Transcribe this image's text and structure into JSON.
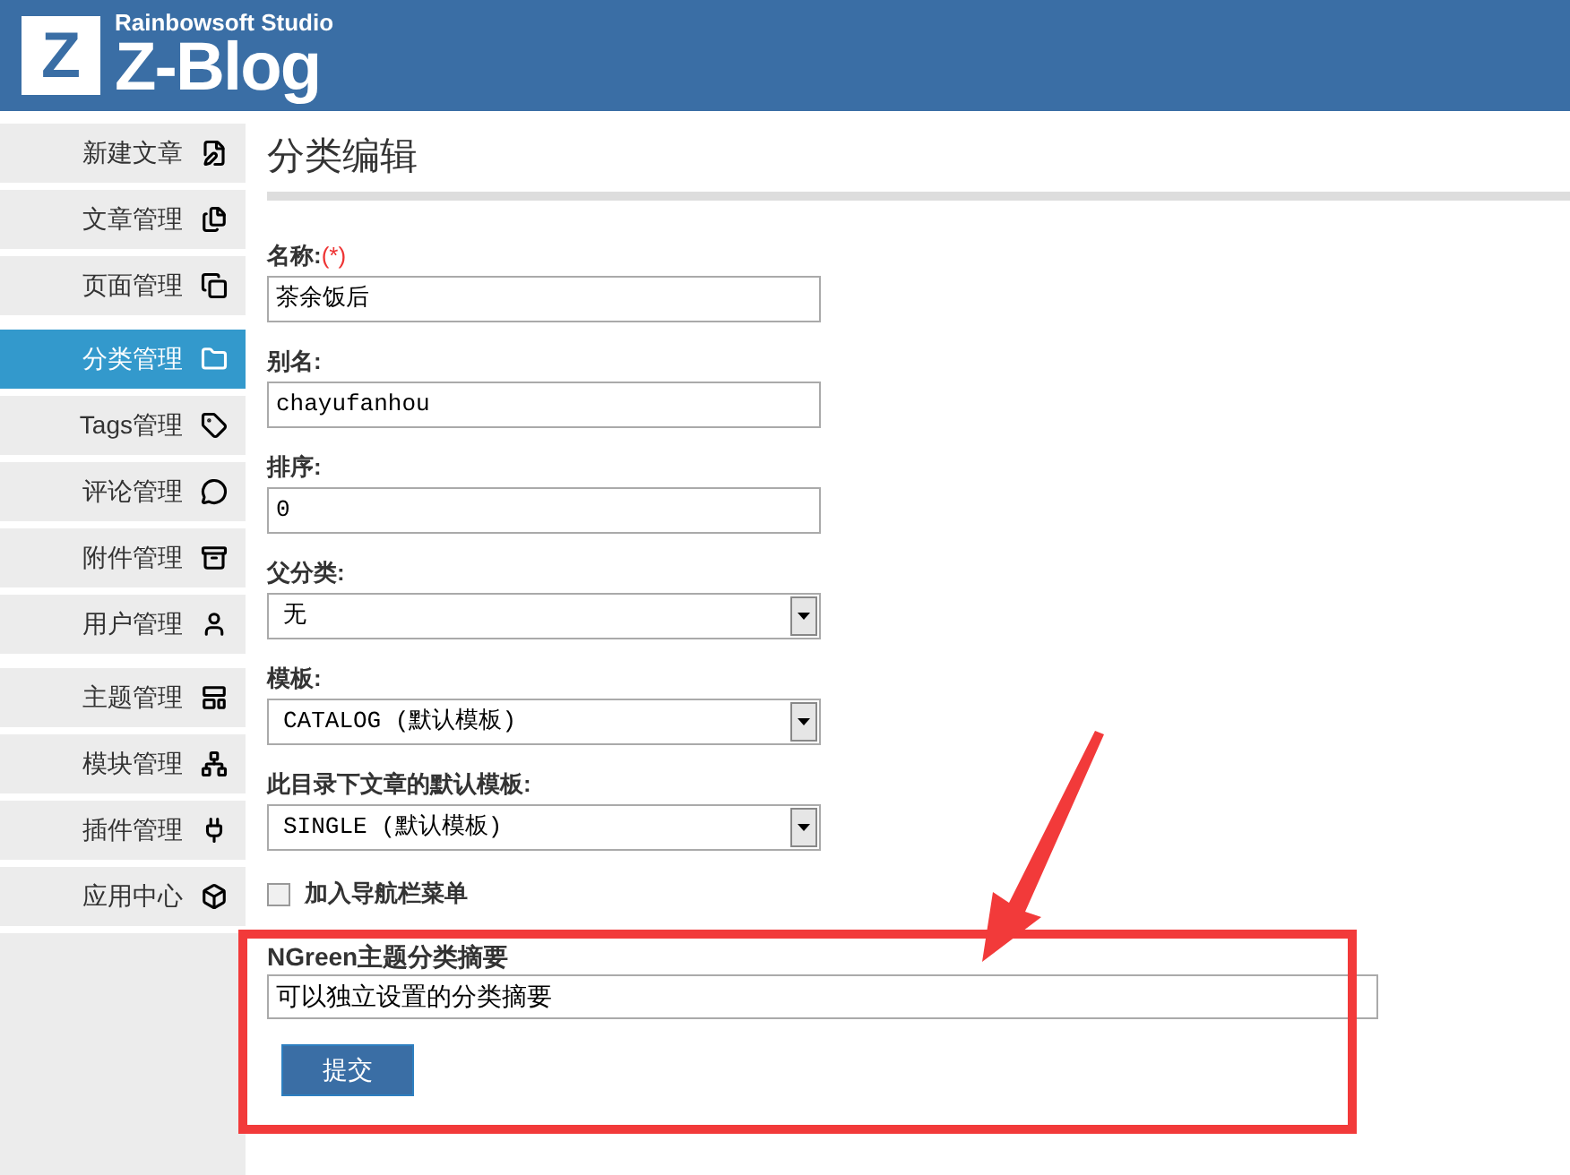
{
  "header": {
    "logo_letter": "Z",
    "studio": "Rainbowsoft Studio",
    "brand": "Z-Blog"
  },
  "sidebar": {
    "groups": [
      [
        {
          "label": "新建文章",
          "selected": false
        },
        {
          "label": "文章管理",
          "selected": false
        },
        {
          "label": "页面管理",
          "selected": false
        }
      ],
      [
        {
          "label": "分类管理",
          "selected": true
        },
        {
          "label": "Tags管理",
          "selected": false
        },
        {
          "label": "评论管理",
          "selected": false
        },
        {
          "label": "附件管理",
          "selected": false
        },
        {
          "label": "用户管理",
          "selected": false
        }
      ],
      [
        {
          "label": "主题管理",
          "selected": false
        },
        {
          "label": "模块管理",
          "selected": false
        },
        {
          "label": "插件管理",
          "selected": false
        },
        {
          "label": "应用中心",
          "selected": false
        }
      ]
    ]
  },
  "page_title": "分类编辑",
  "fields": [
    {
      "kind": "text",
      "label": "名称:",
      "required_mark": "(*)",
      "value": "茶余饭后"
    },
    {
      "kind": "text",
      "label": "别名:",
      "value": "chayufanhou"
    },
    {
      "kind": "text",
      "label": "排序:",
      "value": "0"
    },
    {
      "kind": "select",
      "label": "父分类:",
      "value": "无"
    },
    {
      "kind": "select",
      "label": "模板:",
      "value": "CATALOG (默认模板)"
    },
    {
      "kind": "select",
      "label": "此目录下文章的默认模板:",
      "value": "SINGLE (默认模板)"
    },
    {
      "kind": "checkbox",
      "label": "加入导航栏菜单",
      "checked": false
    }
  ],
  "summary": {
    "label": "NGreen主题分类摘要",
    "value": "可以独立设置的分类摘要"
  },
  "submit": "提交"
}
